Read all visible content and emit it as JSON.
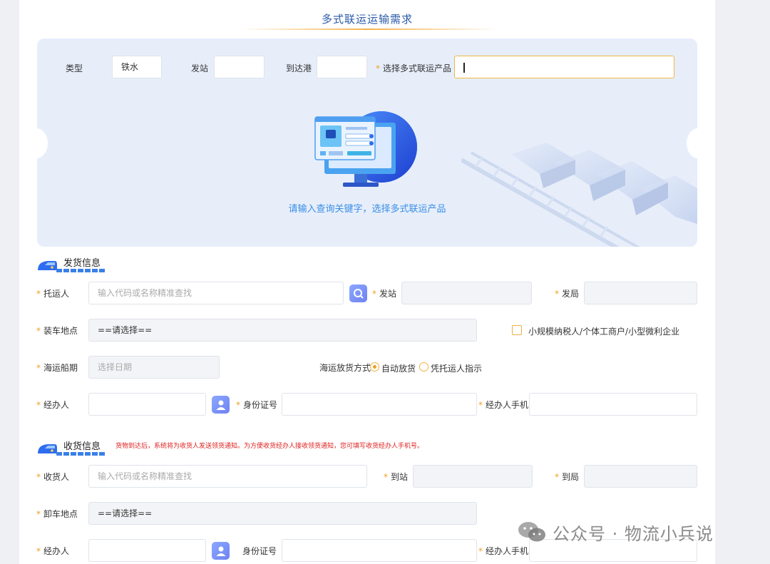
{
  "header": {
    "title": "多式联运运输需求"
  },
  "search_panel": {
    "type_label": "类型",
    "type_value": "铁水",
    "from_station_label": "发站",
    "from_station_value": "",
    "arrival_port_label": "到达港",
    "arrival_port_value": "",
    "product_label": "选择多式联运产品",
    "product_value": "",
    "hint": "请输入查询关键字，选择多式联运产品"
  },
  "shipper_section": {
    "title": "发货信息",
    "shipper_label": "托运人",
    "shipper_placeholder": "输入代码或名称精准查找",
    "from_station_label": "发站",
    "from_bureau_label": "发局",
    "loading_place_label": "装车地点",
    "loading_place_value": "==请选择==",
    "small_taxpayer_label": "小规模纳税人/个体工商户/小型微利企业",
    "sailing_date_label": "海运船期",
    "sailing_date_placeholder": "选择日期",
    "release_mode_label": "海运放货方式",
    "release_options": [
      "自动放货",
      "凭托运人指示"
    ],
    "release_selected": "自动放货",
    "handler_label": "经办人",
    "id_number_label": "身份证号",
    "handler_phone_label": "经办人手机"
  },
  "consignee_section": {
    "title": "收货信息",
    "notice": "货物到达后，系统将为收货人发送领货通知。为方便收货经办人接收领货通知，您可填写收货经办人手机号。",
    "consignee_label": "收货人",
    "consignee_placeholder": "输入代码或名称精准查找",
    "to_station_label": "到站",
    "to_bureau_label": "到局",
    "unloading_place_label": "卸车地点",
    "unloading_place_value": "==请选择==",
    "handler_label": "经办人",
    "id_number_label": "身份证号",
    "handler_phone_label": "经办人手机"
  },
  "watermark": {
    "text": "公众号 · 物流小兵说",
    "icon": "wechat-icon"
  },
  "colors": {
    "accent": "#f0a020",
    "brand_blue": "#3a7fe8",
    "panel_bg": "#e7eefa",
    "notice_red": "#e02020"
  }
}
